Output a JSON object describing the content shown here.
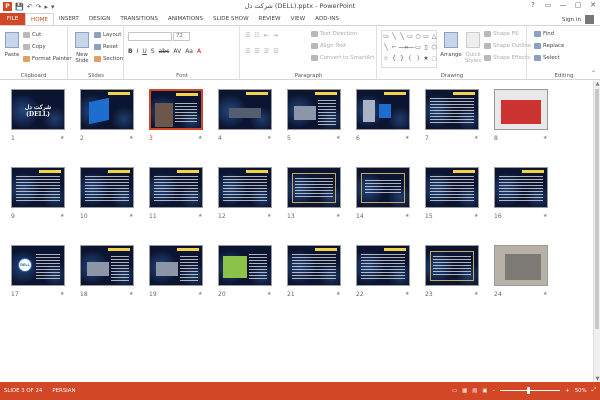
{
  "window": {
    "title": "شرکت دل (DELL).pptx - PowerPoint",
    "controls": [
      "?",
      "▭",
      "—",
      "▢",
      "✕"
    ]
  },
  "qat": {
    "save": "💾",
    "undo": "↶",
    "redo": "↷",
    "start": "▸",
    "customize": "▾"
  },
  "tabs": [
    "FILE",
    "HOME",
    "INSERT",
    "DESIGN",
    "TRANSITIONS",
    "ANIMATIONS",
    "SLIDE SHOW",
    "REVIEW",
    "VIEW",
    "ADD-INS"
  ],
  "active_tab": "HOME",
  "signin": "Sign in",
  "ribbon": {
    "clipboard": {
      "label": "Clipboard",
      "paste": "Paste",
      "cut": "Cut",
      "copy": "Copy",
      "format_painter": "Format Painter"
    },
    "slides": {
      "label": "Slides",
      "new_slide": "New Slide",
      "layout": "Layout",
      "reset": "Reset",
      "section": "Section"
    },
    "font": {
      "label": "Font",
      "size": "72",
      "format_buttons": [
        "B",
        "I",
        "U",
        "S",
        "abc",
        "AV",
        "Aa",
        "A"
      ]
    },
    "paragraph": {
      "label": "Paragraph",
      "text_direction": "Text Direction",
      "align_text": "Align Text",
      "convert_smartart": "Convert to SmartArt"
    },
    "drawing": {
      "label": "Drawing",
      "arrange": "Arrange",
      "quick_styles": "Quick Styles",
      "shape_fill": "Shape Fill",
      "shape_outline": "Shape Outline",
      "shape_effects": "Shape Effects",
      "shapes": [
        "▭",
        "╲",
        "╲",
        "▭",
        "○",
        "▭",
        "△",
        "╲",
        "⌐",
        "⟶",
        "⟵",
        "▭",
        "▯",
        "⬡",
        "☆",
        "{",
        "}",
        "(",
        ")",
        "★",
        "◌"
      ]
    },
    "editing": {
      "label": "Editing",
      "find": "Find",
      "replace": "Replace",
      "select": "Select"
    }
  },
  "slides": [
    {
      "num": "1",
      "title": "شرکت دل (DELL)"
    },
    {
      "num": "2"
    },
    {
      "num": "3"
    },
    {
      "num": "4"
    },
    {
      "num": "5"
    },
    {
      "num": "6"
    },
    {
      "num": "7"
    },
    {
      "num": "8"
    },
    {
      "num": "9"
    },
    {
      "num": "10"
    },
    {
      "num": "11"
    },
    {
      "num": "12"
    },
    {
      "num": "13"
    },
    {
      "num": "14"
    },
    {
      "num": "15"
    },
    {
      "num": "16"
    },
    {
      "num": "17",
      "logo": "DELL"
    },
    {
      "num": "18"
    },
    {
      "num": "19"
    },
    {
      "num": "20"
    },
    {
      "num": "21"
    },
    {
      "num": "22"
    },
    {
      "num": "23"
    },
    {
      "num": "24"
    }
  ],
  "selected_slide": "3",
  "star_glyph": "★",
  "status": {
    "slide_info": "SLIDE 3 OF 24",
    "language": "PERSIAN",
    "zoom": "50%",
    "zoom_minus": "–",
    "zoom_plus": "+"
  }
}
